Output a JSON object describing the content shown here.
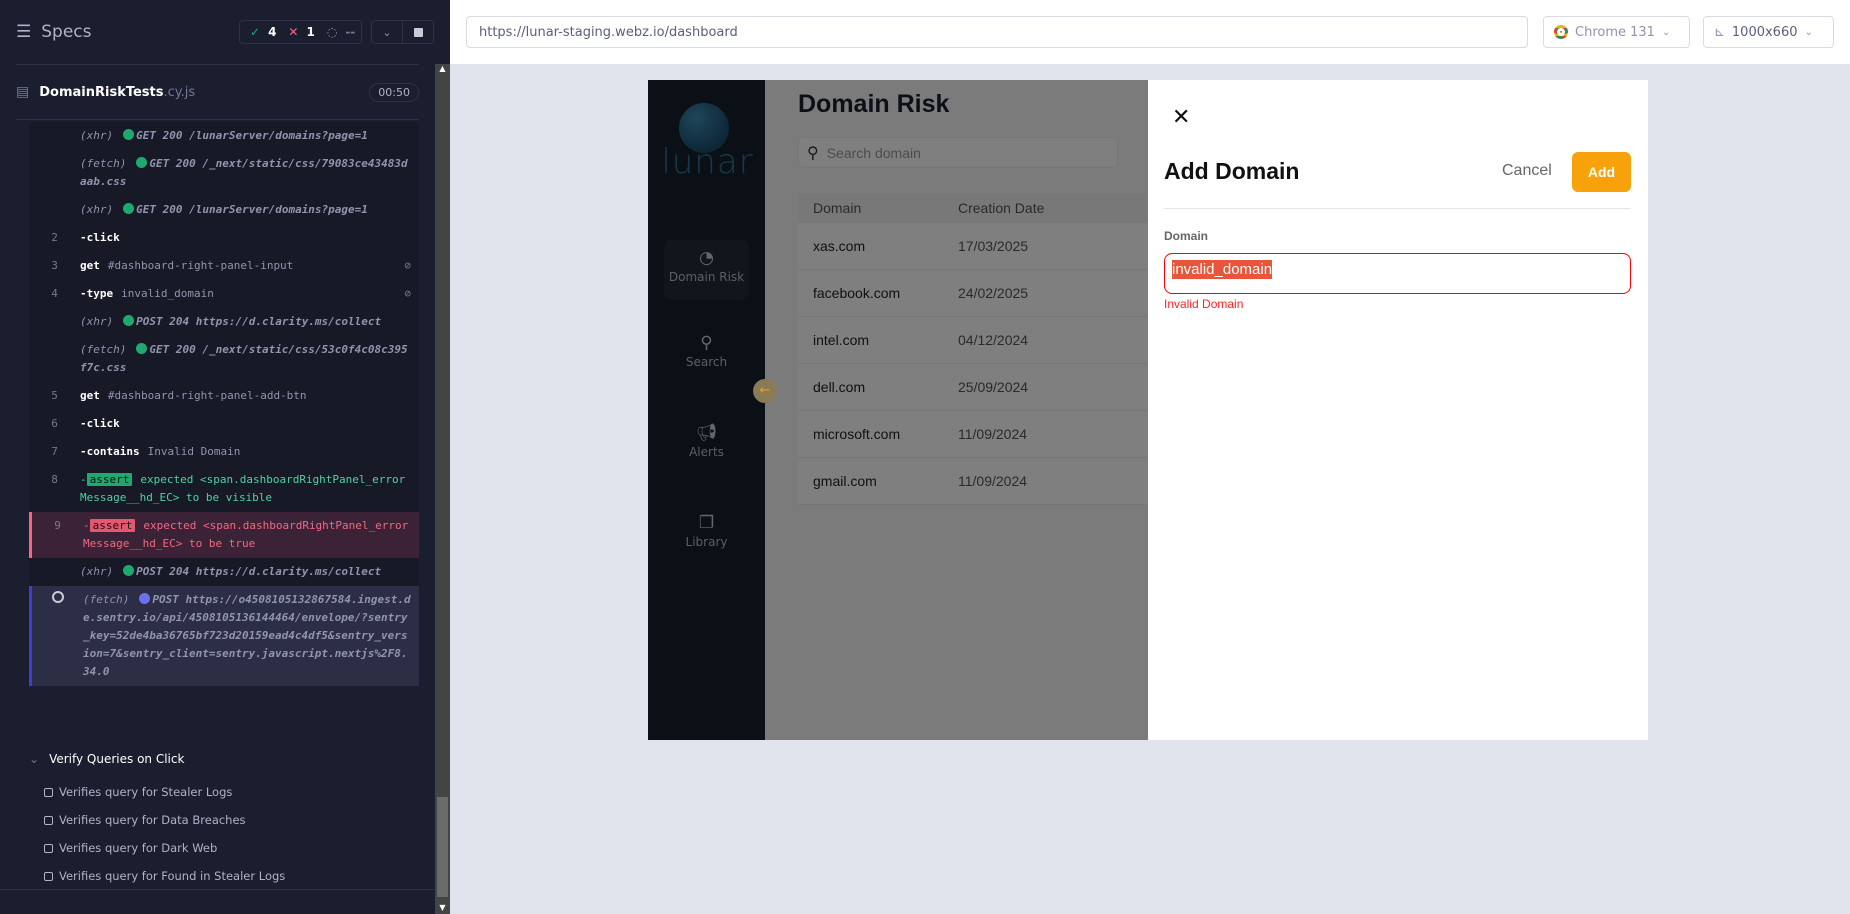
{
  "reporter": {
    "specs_label": "Specs",
    "stats": {
      "passed": "4",
      "failed": "1",
      "pending": "--"
    },
    "file": {
      "name": "DomainRiskTests",
      "ext": ".cy.js",
      "duration": "00:50"
    },
    "log": [
      {
        "type": "request",
        "kind": "(xhr)",
        "dot": "#1fa971",
        "text": "GET 200 /lunarServer/domains?page=1"
      },
      {
        "type": "request",
        "kind": "(fetch)",
        "dot": "#1fa971",
        "text": "GET 200 /_next/static/css/79083ce43483daab.css"
      },
      {
        "type": "request",
        "kind": "(xhr)",
        "dot": "#1fa971",
        "text": "GET 200 /lunarServer/domains?page=1"
      },
      {
        "type": "command",
        "num": "2",
        "name": "-click",
        "arg": ""
      },
      {
        "type": "command",
        "num": "3",
        "name": "get",
        "arg": "#dashboard-right-panel-input",
        "hidden": true
      },
      {
        "type": "command",
        "num": "4",
        "name": "-type",
        "arg": "invalid_domain",
        "hidden": true
      },
      {
        "type": "request",
        "kind": "(xhr)",
        "dot": "#1fa971",
        "text": "POST 204 https://d.clarity.ms/collect"
      },
      {
        "type": "request",
        "kind": "(fetch)",
        "dot": "#1fa971",
        "text": "GET 200 /_next/static/css/53c0f4c08c395f7c.css"
      },
      {
        "type": "command",
        "num": "5",
        "name": "get",
        "arg": "#dashboard-right-panel-add-btn"
      },
      {
        "type": "command",
        "num": "6",
        "name": "-click",
        "arg": ""
      },
      {
        "type": "command",
        "num": "7",
        "name": "-contains",
        "arg": "Invalid Domain"
      },
      {
        "type": "assert",
        "num": "8",
        "status": "pass",
        "label": "assert",
        "text": "expected <span.dashboardRightPanel_errorMessage__hd_EC> to be visible"
      },
      {
        "type": "assert",
        "num": "9",
        "status": "fail",
        "label": "assert",
        "text": "expected <span.dashboardRightPanel_errorMessage__hd_EC> to be true"
      },
      {
        "type": "request",
        "kind": "(xhr)",
        "dot": "#1fa971",
        "text": "POST 204 https://d.clarity.ms/collect"
      },
      {
        "type": "request",
        "kind": "(fetch)",
        "dot": "#6b70f0",
        "pending": true,
        "text": "POST https://o4508105132867584.ingest.de.sentry.io/api/4508105136144464/envelope/?sentry_key=52de4ba36765bf723d20159ead4c4df5&sentry_version=7&sentry_client=sentry.javascript.nextjs%2F8.34.0"
      }
    ],
    "suite": {
      "title": "Verify Queries on Click",
      "tests": [
        "Verifies query for Stealer Logs",
        "Verifies query for Data Breaches",
        "Verifies query for Dark Web",
        "Verifies query for Found in Stealer Logs"
      ]
    }
  },
  "topbar": {
    "url": "https://lunar-staging.webz.io/dashboard",
    "browser": "Chrome 131",
    "viewport": "1000x660"
  },
  "app": {
    "logo_text": "lunar",
    "nav": [
      {
        "label": "Domain Risk",
        "icon": "pie-chart-icon",
        "active": true
      },
      {
        "label": "Search",
        "icon": "search-icon"
      },
      {
        "label": "Alerts",
        "icon": "megaphone-icon"
      },
      {
        "label": "Library",
        "icon": "folder-icon"
      }
    ],
    "page_title": "Domain Risk",
    "search_placeholder": "Search domain",
    "table": {
      "columns": [
        "Domain",
        "Creation Date"
      ],
      "rows": [
        [
          "xas.com",
          "17/03/2025"
        ],
        [
          "facebook.com",
          "24/02/2025"
        ],
        [
          "intel.com",
          "04/12/2024"
        ],
        [
          "dell.com",
          "25/09/2024"
        ],
        [
          "microsoft.com",
          "11/09/2024"
        ],
        [
          "gmail.com",
          "11/09/2024"
        ]
      ]
    },
    "drawer": {
      "title": "Add Domain",
      "cancel": "Cancel",
      "add": "Add",
      "field_label": "Domain",
      "field_value": "invalid_domain",
      "error": "Invalid Domain",
      "accent": "#f7a20a"
    }
  }
}
